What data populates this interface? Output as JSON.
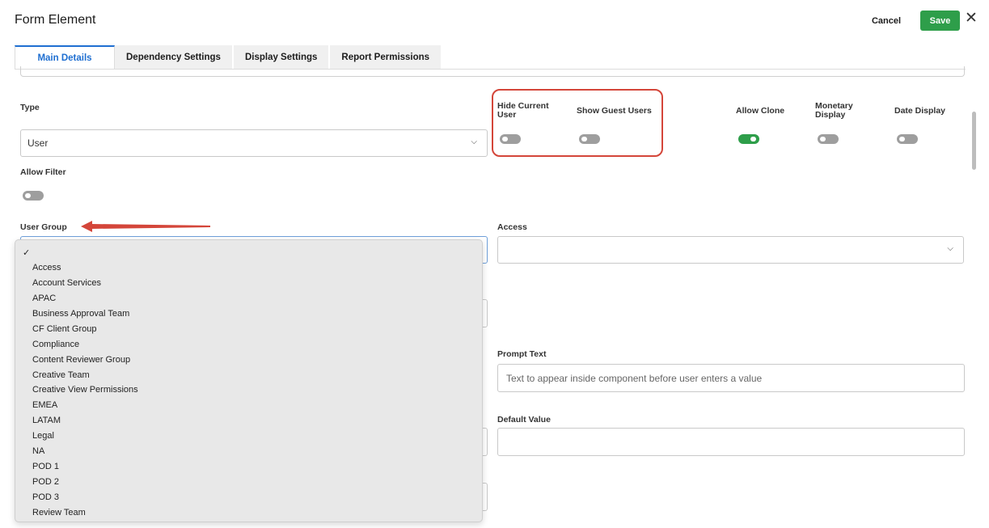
{
  "header": {
    "title": "Form Element",
    "cancel_label": "Cancel",
    "save_label": "Save",
    "close_glyph": "✕"
  },
  "tabs": [
    {
      "label": "Main Details",
      "active": true
    },
    {
      "label": "Dependency Settings",
      "active": false
    },
    {
      "label": "Display Settings",
      "active": false
    },
    {
      "label": "Report Permissions",
      "active": false
    }
  ],
  "fields": {
    "type_label": "Type",
    "type_value": "User",
    "hide_current_user_label": "Hide Current\nUser",
    "show_guest_users_label": "Show Guest Users",
    "allow_clone_label": "Allow Clone",
    "monetary_display_label": "Monetary\nDisplay",
    "date_display_label": "Date Display",
    "allow_filter_label": "Allow Filter",
    "user_group_label": "User Group",
    "access_label": "Access",
    "access_value": "",
    "prompt_text_label": "Prompt Text",
    "prompt_text_placeholder": "Text to appear inside component before user enters a value",
    "default_value_label": "Default Value",
    "default_value_value": ""
  },
  "toggles": {
    "hide_current_user": false,
    "show_guest_users": false,
    "allow_clone": true,
    "monetary_display": false,
    "date_display": false,
    "allow_filter": false
  },
  "user_group_dropdown": {
    "selected_mark": "✓",
    "options": [
      "Access",
      "Account Services",
      "APAC",
      "Business Approval Team",
      "CF Client Group",
      "Compliance",
      "Content Reviewer Group",
      "Creative Team",
      "Creative View Permissions",
      "EMEA",
      "LATAM",
      "Legal",
      "NA",
      "POD 1",
      "POD 2",
      "POD 3",
      "Review Team"
    ]
  },
  "colors": {
    "accent_blue": "#1f6fd1",
    "save_green": "#2e9e4a",
    "annotation_red": "#d4463a"
  }
}
